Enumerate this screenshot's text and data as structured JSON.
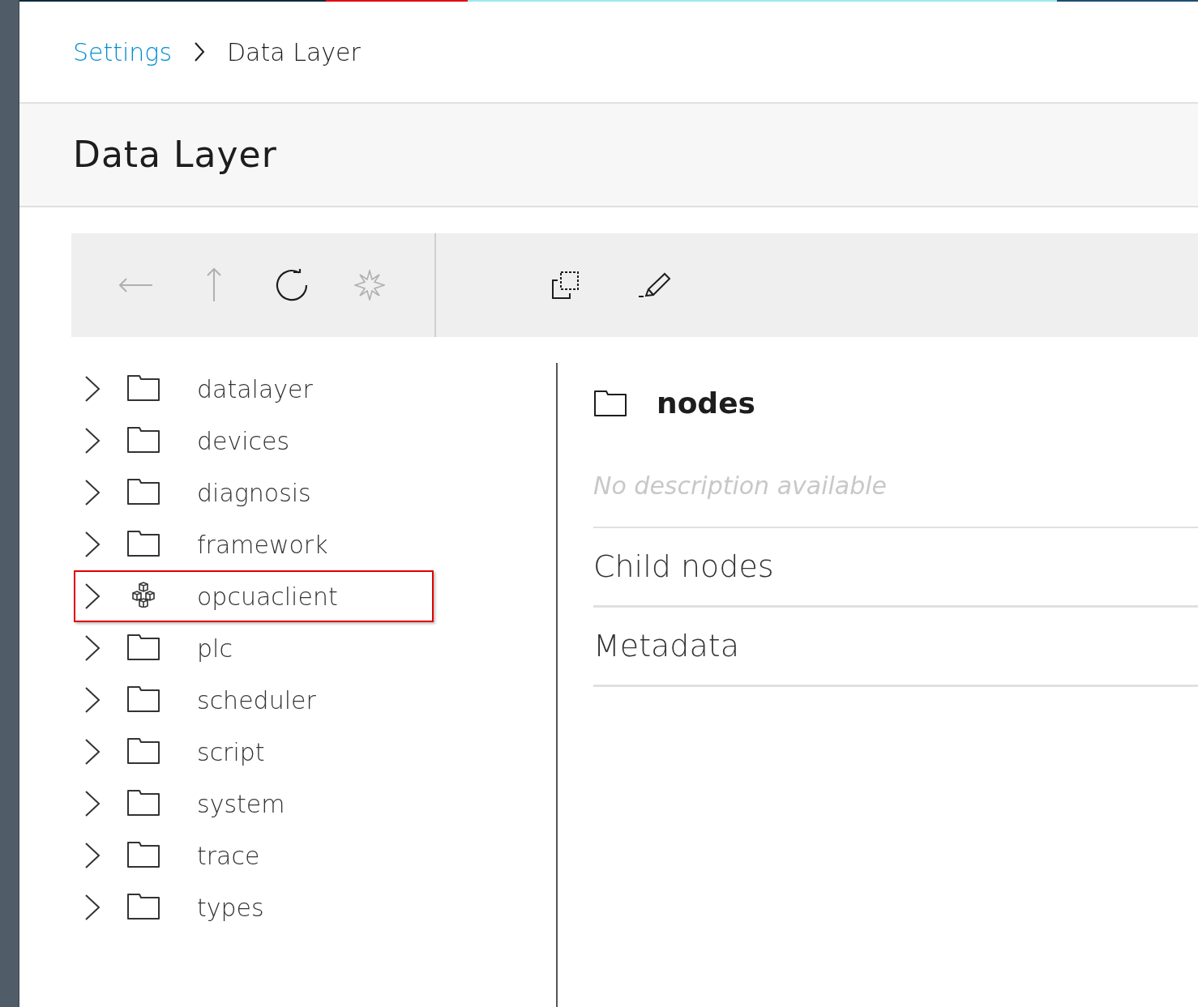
{
  "breadcrumb": [
    {
      "label": "Settings",
      "link": true
    },
    {
      "label": "Data Layer",
      "link": false
    }
  ],
  "page_title": "Data Layer",
  "toolbar": {
    "navigation": [
      {
        "kind": "back",
        "disabled": true
      },
      {
        "kind": "up",
        "disabled": true
      },
      {
        "kind": "refresh",
        "disabled": false
      },
      {
        "kind": "star",
        "disabled": true
      }
    ],
    "actions": [
      {
        "kind": "copy",
        "disabled": false
      },
      {
        "kind": "edit",
        "disabled": false
      }
    ]
  },
  "tree": [
    {
      "label": "datalayer",
      "kind": "folder",
      "highlighted": false
    },
    {
      "label": "devices",
      "kind": "folder",
      "highlighted": false
    },
    {
      "label": "diagnosis",
      "kind": "folder",
      "highlighted": false
    },
    {
      "label": "framework",
      "kind": "folder",
      "highlighted": false
    },
    {
      "label": "opcuaclient",
      "kind": "component",
      "highlighted": true
    },
    {
      "label": "plc",
      "kind": "folder",
      "highlighted": false
    },
    {
      "label": "scheduler",
      "kind": "folder",
      "highlighted": false
    },
    {
      "label": "script",
      "kind": "folder",
      "highlighted": false
    },
    {
      "label": "system",
      "kind": "folder",
      "highlighted": false
    },
    {
      "label": "trace",
      "kind": "folder",
      "highlighted": false
    },
    {
      "label": "types",
      "kind": "folder",
      "highlighted": false
    }
  ],
  "detail": {
    "title": "nodes",
    "description": "No description available",
    "sections": [
      "Child nodes",
      "Metadata"
    ]
  }
}
